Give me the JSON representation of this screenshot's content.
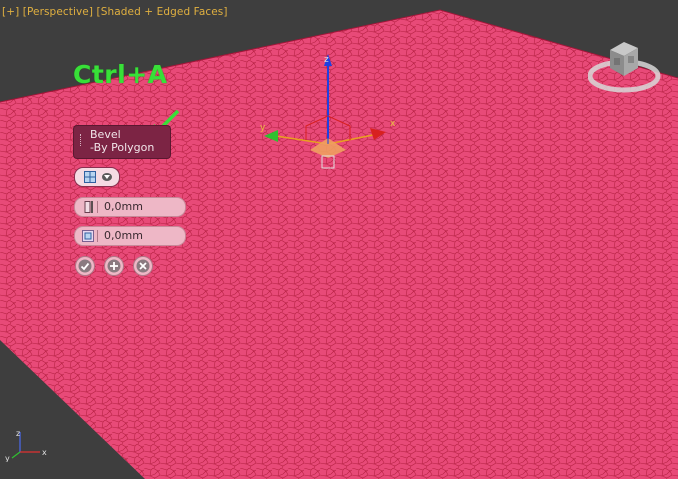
{
  "viewport": {
    "label_segments": [
      "[+]",
      "[Perspective]",
      "[Shaded + Edged Faces]"
    ],
    "plane_color": "#e84a78",
    "edge_color": "#b01c3c",
    "background_color": "#3e3e3e"
  },
  "annotation": {
    "hotkey_text": "Ctrl+A",
    "arrow_color": "#38e038"
  },
  "caddy": {
    "title_line1": "Bevel",
    "title_line2": "-By Polygon",
    "mode_icon": "grid-icon",
    "height": {
      "icon": "height-icon",
      "value": "0,0mm"
    },
    "outline": {
      "icon": "outline-icon",
      "value": "0,0mm"
    },
    "buttons": [
      {
        "name": "ok",
        "icon": "checkmark-icon"
      },
      {
        "name": "apply",
        "icon": "plus-icon"
      },
      {
        "name": "cancel",
        "icon": "x-icon"
      }
    ]
  },
  "gizmo": {
    "x_label": "x",
    "y_label": "y",
    "z_label": "z"
  },
  "corner_axis": {
    "x_label": "x",
    "y_label": "y",
    "z_label": "z"
  }
}
